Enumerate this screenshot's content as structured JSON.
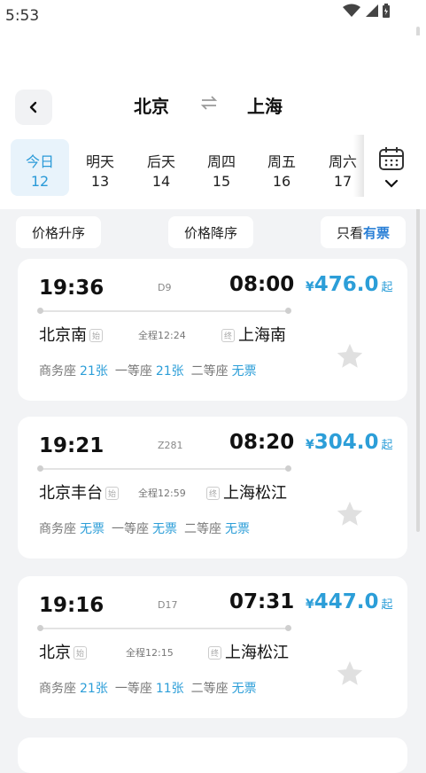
{
  "status_bar": {
    "time": "5:53",
    "icons": [
      "wifi-icon",
      "signal-icon",
      "battery-icon"
    ]
  },
  "header": {
    "from_city": "北京",
    "to_city": "上海",
    "swap_icon": "swap-arrows-icon",
    "back_icon": "chevron-left-icon"
  },
  "dates": [
    {
      "label": "今日",
      "num": "12",
      "active": true
    },
    {
      "label": "明天",
      "num": "13"
    },
    {
      "label": "后天",
      "num": "14"
    },
    {
      "label": "周四",
      "num": "15"
    },
    {
      "label": "周五",
      "num": "16"
    },
    {
      "label": "周六",
      "num": "17"
    }
  ],
  "calendar_icon": "calendar-icon",
  "sort": {
    "asc": "价格升序",
    "desc": "价格降序",
    "only_prefix": "只看",
    "only_highlight": "有票"
  },
  "trains": [
    {
      "dep_time": "19:36",
      "arr_time": "08:00",
      "train_no": "D9",
      "price_symbol": "¥",
      "price": "476.0",
      "price_suffix": "起",
      "from": "北京南",
      "from_tag": "始",
      "to": "上海南",
      "to_tag": "终",
      "duration": "全程12:24",
      "seats": [
        {
          "name": "商务座",
          "value": "21张"
        },
        {
          "name": "一等座",
          "value": "21张"
        },
        {
          "name": "二等座",
          "value": "无票"
        }
      ]
    },
    {
      "dep_time": "19:21",
      "arr_time": "08:20",
      "train_no": "Z281",
      "price_symbol": "¥",
      "price": "304.0",
      "price_suffix": "起",
      "from": "北京丰台",
      "from_tag": "始",
      "to": "上海松江",
      "to_tag": "终",
      "duration": "全程12:59",
      "seats": [
        {
          "name": "商务座",
          "value": "无票"
        },
        {
          "name": "一等座",
          "value": "无票"
        },
        {
          "name": "二等座",
          "value": "无票"
        }
      ]
    },
    {
      "dep_time": "19:16",
      "arr_time": "07:31",
      "train_no": "D17",
      "price_symbol": "¥",
      "price": "447.0",
      "price_suffix": "起",
      "from": "北京",
      "from_tag": "始",
      "to": "上海松江",
      "to_tag": "终",
      "duration": "全程12:15",
      "seats": [
        {
          "name": "商务座",
          "value": "21张"
        },
        {
          "name": "一等座",
          "value": "11张"
        },
        {
          "name": "二等座",
          "value": "无票"
        }
      ]
    }
  ],
  "colors": {
    "accent": "#2c9ed8",
    "star": "#e0e0e0",
    "background": "#f2f3f5"
  }
}
